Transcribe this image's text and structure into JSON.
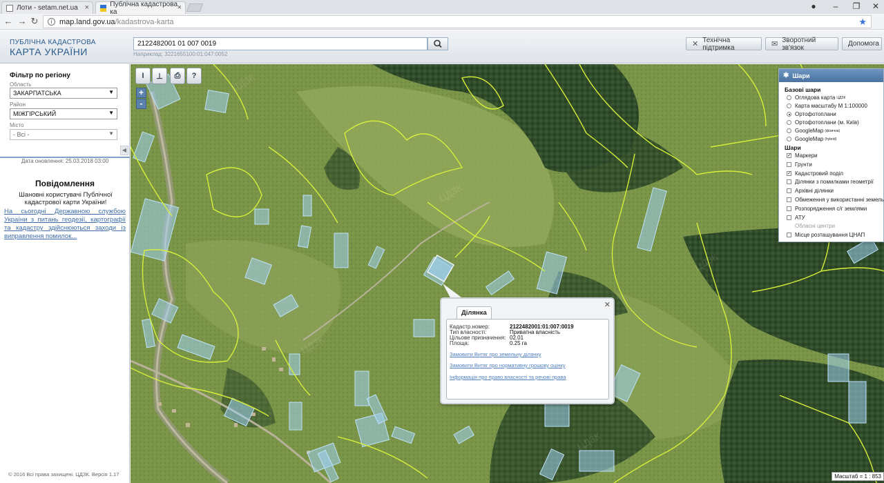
{
  "browser": {
    "tabs": [
      {
        "title": "Лоти - setam.net.ua"
      },
      {
        "title": "Публічна кадастрова ка"
      }
    ],
    "url_host": "map.land.gov.ua",
    "url_path": "/kadastrova-karta"
  },
  "header": {
    "logo_line1": "ПУБЛІЧНА КАДАСТРОВА",
    "logo_line2": "КАРТА УКРАЇНИ",
    "search_value": "2122482001 01 007 0019",
    "search_hint": "Наприклад: 3221655100:01:047:0052",
    "support_label": "Технічна підтримка",
    "feedback_label": "Зворотний зв'язок",
    "help_label": "Допомога"
  },
  "sidebar": {
    "filter_title": "Фільтр по регіону",
    "oblast_label": "Область",
    "oblast_value": "ЗАКАРПАТСЬКА",
    "rayon_label": "Район",
    "rayon_value": "МІЖГІРСЬКИЙ",
    "misto_label": "Місто",
    "misto_value": "- Всі -",
    "updated": "Дата оновлення: 25.03.2018 03:00",
    "messages_title": "Повідомлення",
    "messages_text": "Шановні користувачі Публічної кадастрової карти України!",
    "messages_link": "На сьогодні Державною службою України з питань геодезії, картографії та кадастру здійснюються заходи із виправлення помилок...",
    "footer": "© 2016 Всі права захищені. ЦДЗК. Версія 1.17"
  },
  "map": {
    "tools": {
      "tool1": "I",
      "tool2": "⊥",
      "print": "⎙",
      "info": "?"
    },
    "zoom_in": "+",
    "zoom_out": "-",
    "scale": "Масштаб = 1 : 853"
  },
  "popup": {
    "tab": "Ділянка",
    "rows": [
      {
        "label": "Кадастр.номер:",
        "value": "2122482001:01:007:0019"
      },
      {
        "label": "Тип власності:",
        "value": "Приватна власність"
      },
      {
        "label": "Цільове призначення:",
        "value": "02.01"
      },
      {
        "label": "Площа:",
        "value": "0.25 га"
      }
    ],
    "links": [
      "Замовити Витяг про земельну ділянку",
      "Замовити Витяг про нормативну грошову оцінку",
      "Інформація про право власності та речові права"
    ]
  },
  "layers": {
    "title": "Шари",
    "base_title": "Базові шари",
    "base": [
      {
        "label": "Оглядова карта",
        "sup": "ЦДЗК",
        "checked": false
      },
      {
        "label": "Карта масштабу М 1:100000",
        "sup": "",
        "checked": false
      },
      {
        "label": "Ортофотоплани",
        "sup": "",
        "checked": true
      },
      {
        "label": "Ортофотоплани (м. Київ)",
        "sup": "",
        "checked": false
      },
      {
        "label": "GoogleMap",
        "sup": "(фізична)",
        "checked": false
      },
      {
        "label": "GoogleMap",
        "sup": "(hybrid)",
        "checked": false
      }
    ],
    "layers_title": "Шари",
    "overlays": [
      {
        "label": "Маркери",
        "checked": true,
        "disabled": false
      },
      {
        "label": "Грунти",
        "checked": false,
        "disabled": false
      },
      {
        "label": "Кадастровий поділ",
        "checked": true,
        "disabled": false
      },
      {
        "label": "Ділянки з помилками геометрії",
        "checked": false,
        "disabled": false
      },
      {
        "label": "Архівні ділянки",
        "checked": false,
        "disabled": false
      },
      {
        "label": "Обмеження у використанні земель",
        "checked": false,
        "disabled": false
      },
      {
        "label": "Розпорядження с/г землями",
        "checked": false,
        "disabled": false
      },
      {
        "label": "АТУ",
        "checked": false,
        "disabled": false
      },
      {
        "label": "Обласні центри",
        "checked": false,
        "disabled": true
      },
      {
        "label": "Місце розташування ЦНАП",
        "checked": false,
        "disabled": false
      }
    ]
  },
  "colors": {
    "accent": "#4a73a3",
    "parcel_fill": "#9ecff0",
    "boundary": "#d7ef3a"
  }
}
